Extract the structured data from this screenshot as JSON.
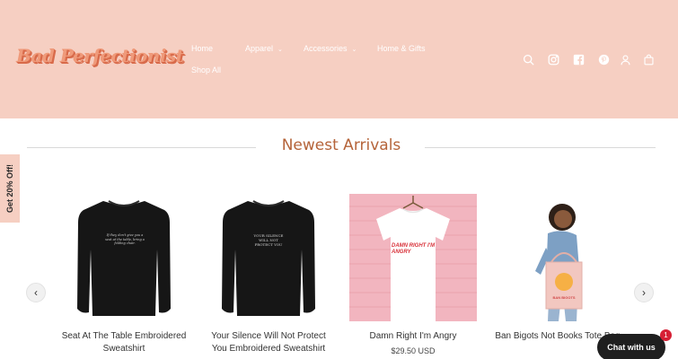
{
  "header": {
    "logo_text": "Bad Perfectionist",
    "nav": [
      {
        "label": "Home",
        "has_dropdown": false
      },
      {
        "label": "Apparel",
        "has_dropdown": true
      },
      {
        "label": "Accessories",
        "has_dropdown": true
      },
      {
        "label": "Home & Gifts",
        "has_dropdown": false
      },
      {
        "label": "Shop All",
        "has_dropdown": false
      }
    ],
    "icons": [
      "search-icon",
      "instagram-icon",
      "facebook-icon",
      "pinterest-icon",
      "account-icon",
      "cart-icon"
    ],
    "background_color": "#f6cfc2"
  },
  "promo_tab": {
    "label": "Get 20% Off!"
  },
  "section": {
    "title": "Newest Arrivals",
    "title_color": "#b5643a"
  },
  "carousel": {
    "prev_label": "‹",
    "next_label": "›",
    "products": [
      {
        "name": "Seat At The Table Embroidered Sweatshirt",
        "price": "",
        "print_text": "If they don't give you a seat at the table, bring a folding chair."
      },
      {
        "name": "Your Silence Will Not Protect You Embroidered Sweatshirt",
        "price": "",
        "print_text": "YOUR SILENCE WILL NOT PROTECT YOU"
      },
      {
        "name": "Damn Right I'm Angry",
        "price": "$29.50 USD",
        "print_text": "DAMN RIGHT I'M ANGRY"
      },
      {
        "name": "Ban Bigots Not Books Tote Bag",
        "price": "",
        "print_text": "BAN BIGOTS"
      }
    ]
  },
  "chat": {
    "label": "Chat with us",
    "badge_count": "1"
  }
}
